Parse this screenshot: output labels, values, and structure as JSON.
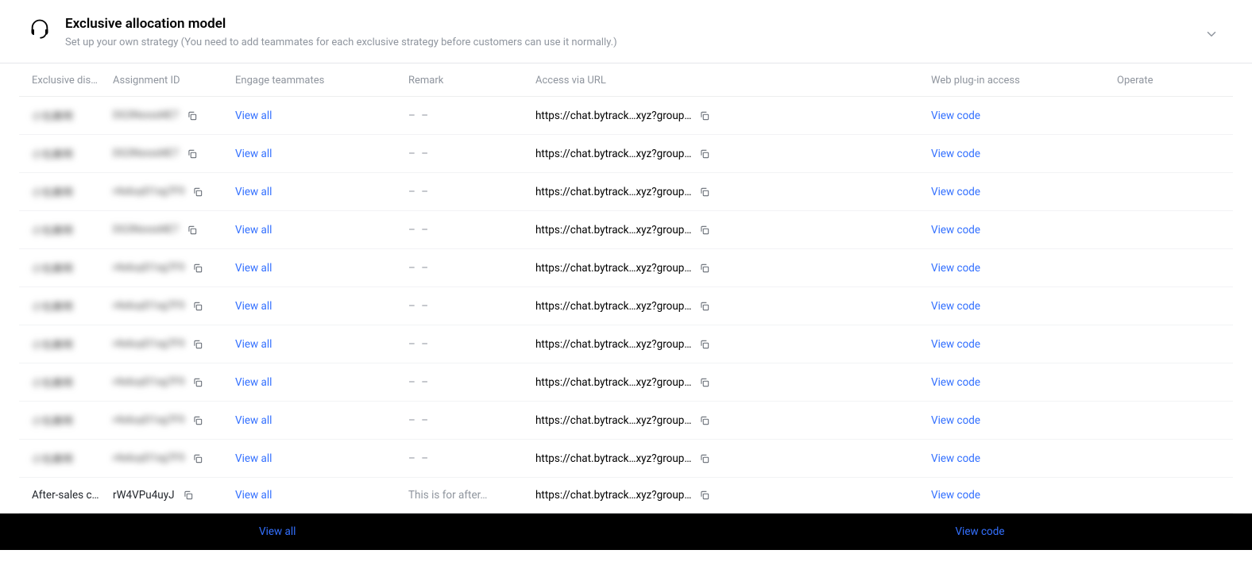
{
  "header": {
    "title": "Exclusive allocation model",
    "subtitle": "Set up your own strategy (You need to add teammates for each exclusive strategy before customers can use it normally.)"
  },
  "columns": {
    "distri": "Exclusive distri…",
    "id": "Assignment ID",
    "engage": "Engage teammates",
    "remark": "Remark",
    "url": "Access via URL",
    "plugin": "Web plug-in access",
    "operate": "Operate"
  },
  "labels": {
    "view_all": "View all",
    "view_code": "View code",
    "empty": "– –"
  },
  "rows": [
    {
      "name_blur": "小包裹啊",
      "id_blur": "DG3Nxxsd4E7",
      "engage": "View all",
      "remark": "",
      "url": "https://chat.bytrack…xyz?group…",
      "plugin": "View code"
    },
    {
      "name_blur": "小包裹啊",
      "id_blur": "DG3Nxxsd4E7",
      "engage": "View all",
      "remark": "",
      "url": "https://chat.bytrack…xyz?group…",
      "plugin": "View code"
    },
    {
      "name_blur": "小包裹啊",
      "id_blur": "r4s6uyD1xg7F9",
      "engage": "View all",
      "remark": "",
      "url": "https://chat.bytrack…xyz?group…",
      "plugin": "View code"
    },
    {
      "name_blur": "小包裹啊",
      "id_blur": "DG3Nxxsd4E7",
      "engage": "View all",
      "remark": "",
      "url": "https://chat.bytrack…xyz?group…",
      "plugin": "View code"
    },
    {
      "name_blur": "小包裹啊",
      "id_blur": "r4s6uyD1xg7F9",
      "engage": "View all",
      "remark": "",
      "url": "https://chat.bytrack…xyz?group…",
      "plugin": "View code"
    },
    {
      "name_blur": "小包裹啊",
      "id_blur": "r4s6uyD1xg7F9",
      "engage": "View all",
      "remark": "",
      "url": "https://chat.bytrack…xyz?group…",
      "plugin": "View code"
    },
    {
      "name_blur": "小包裹啊",
      "id_blur": "r4s6uyD1xg7F9",
      "engage": "View all",
      "remark": "",
      "url": "https://chat.bytrack…xyz?group…",
      "plugin": "View code"
    },
    {
      "name_blur": "小包裹啊",
      "id_blur": "r4s6uyD1xg7F9",
      "engage": "View all",
      "remark": "",
      "url": "https://chat.bytrack…xyz?group…",
      "plugin": "View code"
    },
    {
      "name_blur": "小包裹啊",
      "id_blur": "r4s6uyD1xg7F9",
      "engage": "View all",
      "remark": "",
      "url": "https://chat.bytrack…xyz?group…",
      "plugin": "View code"
    },
    {
      "name_blur": "小包裹啊",
      "id_blur": "r4s6uyD1xg7F9",
      "engage": "View all",
      "remark": "",
      "url": "https://chat.bytrack…xyz?group…",
      "plugin": "View code"
    },
    {
      "name": "After-sales cu…",
      "id": "rW4VPu4uyJ",
      "engage": "View all",
      "remark": "This is for after…",
      "url": "https://chat.bytrack…xyz?group…",
      "plugin": "View code"
    }
  ],
  "bottom": {
    "engage": "View all",
    "plugin": "View code"
  }
}
